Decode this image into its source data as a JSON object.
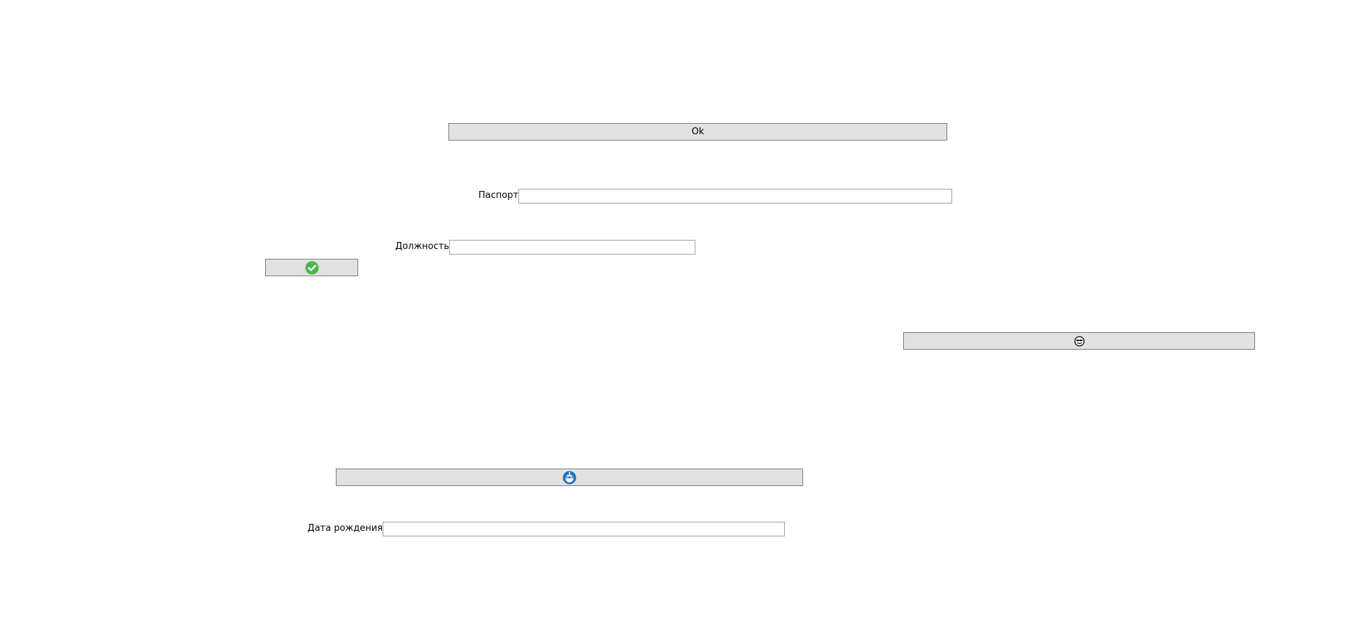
{
  "buttons": {
    "ok_label": "Ok"
  },
  "fields": {
    "passport": {
      "label": "Паспорт",
      "value": "",
      "placeholder": ""
    },
    "position": {
      "label": "Должность",
      "value": "",
      "placeholder": ""
    },
    "birth_date": {
      "label": "Дата рождения",
      "value": "",
      "placeholder": ""
    }
  },
  "icons": {
    "confirm": "check-circle-icon",
    "face": "face-icon",
    "robot": "robot-icon"
  },
  "colors": {
    "button_bg": "#e1e1e1",
    "button_border": "#7a7a7a",
    "input_border": "#a0a0a0",
    "check_green": "#4cb748",
    "robot_blue": "#1e73be"
  }
}
